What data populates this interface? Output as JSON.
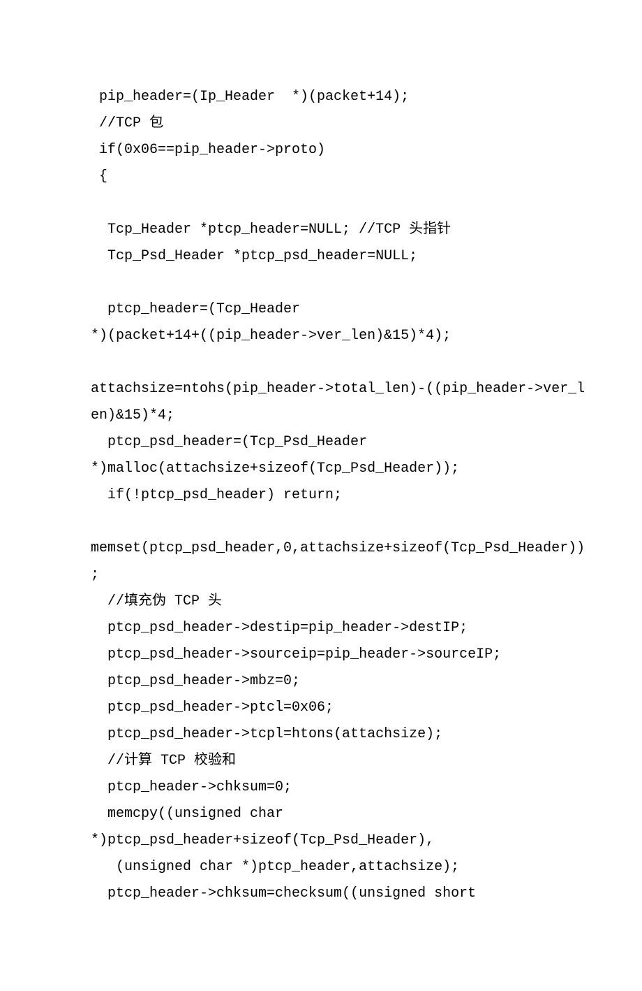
{
  "lines": [
    " pip_header=(Ip_Header  *)(packet+14);",
    " //TCP 包",
    " if(0x06==pip_header->proto)",
    " {",
    "",
    "  Tcp_Header *ptcp_header=NULL; //TCP 头指针",
    "  Tcp_Psd_Header *ptcp_psd_header=NULL;",
    "",
    "  ptcp_header=(Tcp_Header",
    "*)(packet+14+((pip_header->ver_len)&15)*4);",
    "",
    "attachsize=ntohs(pip_header->total_len)-((pip_header->ver_l",
    "en)&15)*4;",
    "  ptcp_psd_header=(Tcp_Psd_Header",
    "*)malloc(attachsize+sizeof(Tcp_Psd_Header));",
    "  if(!ptcp_psd_header) return;",
    "",
    "memset(ptcp_psd_header,0,attachsize+sizeof(Tcp_Psd_Header))",
    ";",
    "  //填充伪 TCP 头",
    "  ptcp_psd_header->destip=pip_header->destIP;",
    "  ptcp_psd_header->sourceip=pip_header->sourceIP;",
    "  ptcp_psd_header->mbz=0;",
    "  ptcp_psd_header->ptcl=0x06;",
    "  ptcp_psd_header->tcpl=htons(attachsize);",
    "  //计算 TCP 校验和",
    "  ptcp_header->chksum=0;",
    "  memcpy((unsigned char",
    "*)ptcp_psd_header+sizeof(Tcp_Psd_Header),",
    "   (unsigned char *)ptcp_header,attachsize);",
    "  ptcp_header->chksum=checksum((unsigned short"
  ]
}
